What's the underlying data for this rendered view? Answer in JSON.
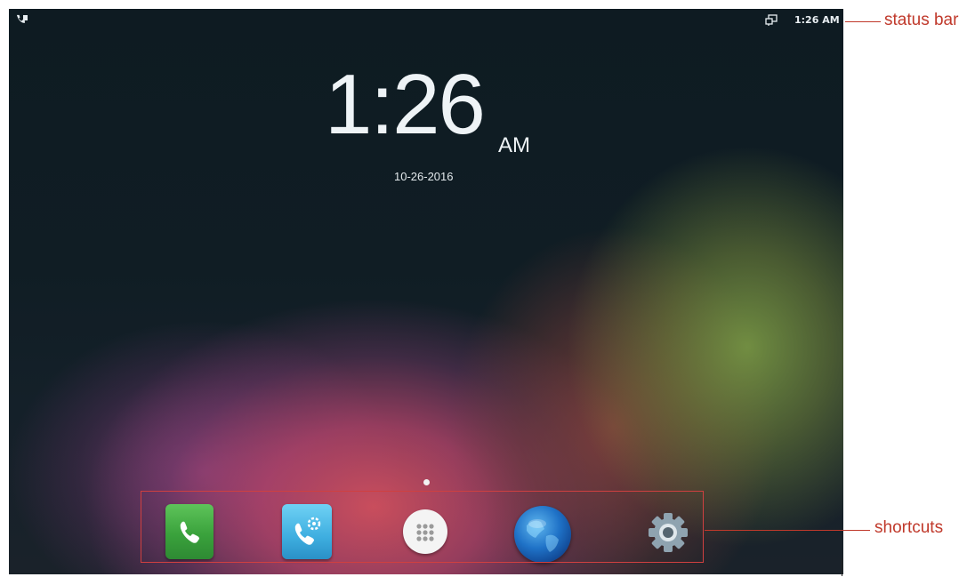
{
  "status_bar": {
    "left_icon": "phone-contacts-icon",
    "left_icon_glyph": "₵₿",
    "right_icon": "screen-mirror-icon",
    "time": "1:26 AM"
  },
  "clock": {
    "time": "1:26",
    "ampm": "AM",
    "date": "10-26-2016"
  },
  "dock": {
    "apps": [
      {
        "name": "phone-icon"
      },
      {
        "name": "call-settings-icon"
      },
      {
        "name": "app-drawer-icon"
      },
      {
        "name": "browser-globe-icon"
      },
      {
        "name": "settings-gear-icon"
      }
    ]
  },
  "annotations": {
    "status_bar_label": "status bar",
    "shortcuts_label": "shortcuts",
    "color": "#c0392b"
  }
}
